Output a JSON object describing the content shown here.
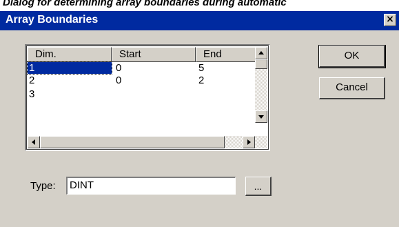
{
  "caption": "Dialog for determining array boundaries during automatic",
  "dialog": {
    "title": "Array Boundaries",
    "close_glyph": "×",
    "ok_label": "OK",
    "cancel_label": "Cancel"
  },
  "grid": {
    "columns": [
      "Dim.",
      "Start",
      "End"
    ],
    "rows": [
      {
        "dim": "1",
        "start": "0",
        "end": "5"
      },
      {
        "dim": "2",
        "start": "0",
        "end": "2"
      },
      {
        "dim": "3",
        "start": "",
        "end": ""
      }
    ],
    "selected_row": 0
  },
  "type_field": {
    "label": "Type:",
    "value": "DINT",
    "browse_label": "..."
  },
  "icons": {
    "close": "close-icon",
    "scroll_up": "arrow-up-icon",
    "scroll_down": "arrow-down-icon",
    "scroll_left": "arrow-left-icon",
    "scroll_right": "arrow-right-icon"
  },
  "colors": {
    "title_bar": "#002aa0",
    "face": "#d4d0c8",
    "selection": "#002aa0"
  }
}
